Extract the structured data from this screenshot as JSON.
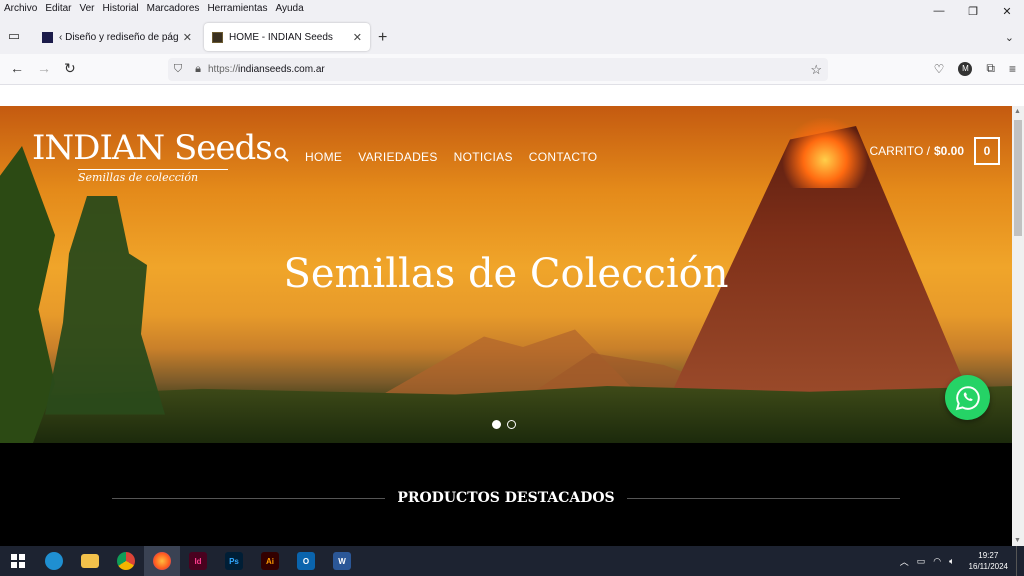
{
  "menu": [
    "Archivo",
    "Editar",
    "Ver",
    "Historial",
    "Marcadores",
    "Herramientas",
    "Ayuda"
  ],
  "tabs": [
    {
      "title": "‹ Diseño y rediseño de páginas"
    },
    {
      "title": "HOME - INDIAN Seeds"
    }
  ],
  "url": {
    "protocol": "https://",
    "host": "indianseeds.com.ar"
  },
  "site": {
    "logo_main": "INDIAN Seeds",
    "logo_sub": "Semillas de colección",
    "nav": [
      "HOME",
      "VARIEDADES",
      "NOTICIAS",
      "CONTACTO"
    ],
    "cart_label": "CARRITO /",
    "cart_amount": "$0.00",
    "cart_count": "0",
    "headline": "Semillas de Colección",
    "section_title": "PRODUCTOS DESTACADOS"
  },
  "clock": {
    "time": "19:27",
    "date": "16/11/2024"
  },
  "colors": {
    "whatsapp": "#25d366",
    "taskbar": "#1d2331"
  }
}
